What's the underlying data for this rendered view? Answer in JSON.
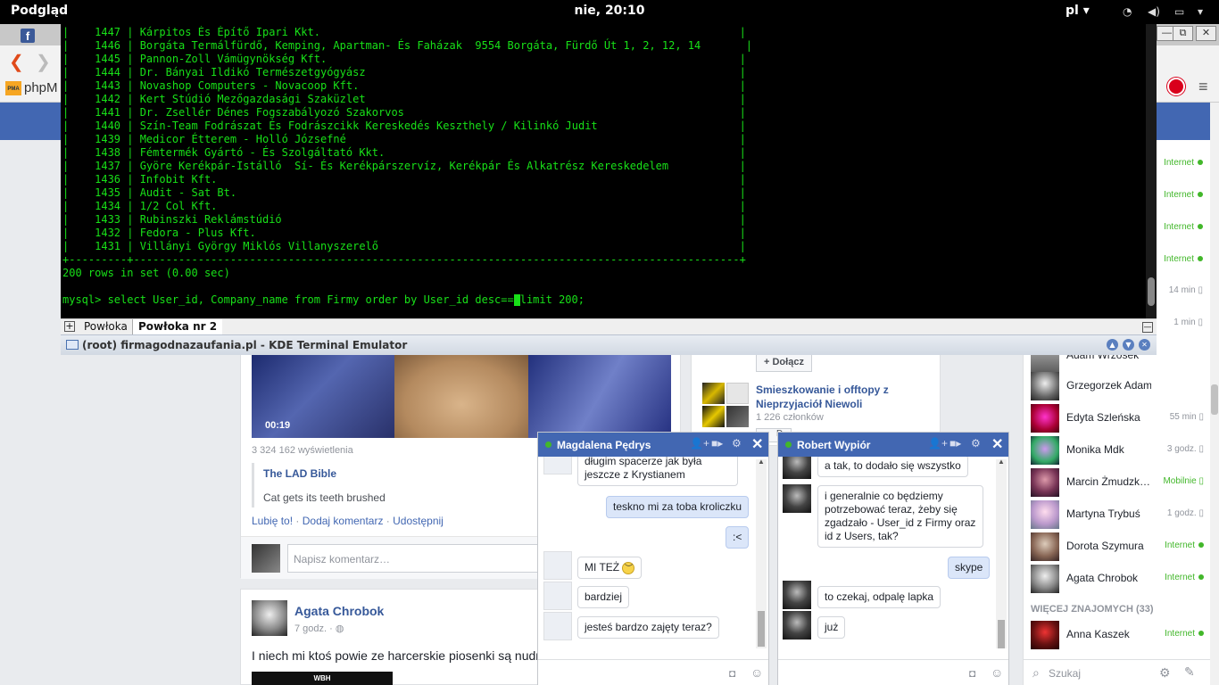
{
  "topbar": {
    "app": "Podgląd",
    "clock": "nie, 20:10",
    "lang": "pl"
  },
  "browser": {
    "phpmyadmin_tab": "phpM",
    "fb_tab": "f"
  },
  "terminal": {
    "rows": [
      "|    1447 | Kárpitos És Építő Ipari Kkt.                                                                 |",
      "|    1446 | Borgáta Termálfürdő, Kemping, Apartman- És Faházak  9554 Borgáta, Fürdő Út 1, 2, 12, 14       |",
      "|    1445 | Pannon-Zoll Vámügynökség Kft.                                                                |",
      "|    1444 | Dr. Bányai Ildikó Természetgyógyász                                                          |",
      "|    1443 | Novashop Computers - Novacoop Kft.                                                           |",
      "|    1442 | Kert Stúdió Mezőgazdasági Szaküzlet                                                          |",
      "|    1441 | Dr. Zsellér Dénes Fogszabályozó Szakorvos                                                    |",
      "|    1440 | Szín-Team Fodrászat És Fodrászcikk Kereskedés Keszthely / Kilinkó Judit                      |",
      "|    1439 | Medicor Étterem - Holló Józsefné                                                             |",
      "|    1438 | Fémtermék Gyártó - És Szolgáltató Kkt.                                                       |",
      "|    1437 | Györe Kerékpár-Istálló  Sí- És Kerékpárszervíz, Kerékpár És Alkatrész Kereskedelem           |",
      "|    1436 | Infobit Kft.                                                                                 |",
      "|    1435 | Audit - Sat Bt.                                                                              |",
      "|    1434 | 1/2 Col Kft.                                                                                 |",
      "|    1433 | Rubinszki Reklámstúdió                                                                       |",
      "|    1432 | Fedora - Plus Kft.                                                                           |",
      "|    1431 | Villányi György Miklós Villanyszerelő                                                        |",
      "+---------+----------------------------------------------------------------------------------------------+",
      "200 rows in set (0.00 sec)",
      ""
    ],
    "prompt_before_cursor": "mysql> select User_id, Company_name from Firmy order by User_id desc==",
    "prompt_after_cursor": "limit 200;",
    "tabs": [
      "Powłoka",
      "Powłoka nr 2"
    ],
    "window_title": "(root) firmagodnazaufania.pl - KDE Terminal Emulator"
  },
  "post1": {
    "duration": "00:19",
    "views": "3 324 162 wyświetlenia",
    "source": "The LAD Bible",
    "caption": "Cat gets its teeth brushed",
    "like": "Lubię to!",
    "comment": "Dodaj komentarz",
    "share": "Udostępnij",
    "comment_placeholder": "Napisz komentarz…"
  },
  "post2": {
    "author": "Agata Chrobok",
    "time": "7 godz. ·",
    "text": "I niech mi ktoś powie ze harcerskie piosenki są nudn",
    "media_label": "WBH"
  },
  "group": {
    "join": "Dołącz",
    "name": "Smieszkowanie i offtopy z Nieprzyjaciół Niewoli",
    "members": "1 226 członków",
    "join2": "D"
  },
  "chat1": {
    "name": "Magdalena Pędrys",
    "messages": [
      "długim spacerze jak była jeszcze z Krystianem",
      "teskno mi za toba kroliczku",
      ":<",
      "MI TEŻ",
      "bardziej",
      "jesteś bardzo zajęty teraz?"
    ]
  },
  "chat2": {
    "name": "Robert Wypiór",
    "messages": [
      "a tak, to dodało się wszystko",
      "i generalnie co będziemy potrzebować teraz, żeby się zgadzało - User_id z Firmy oraz id z Users, tak?",
      "skype",
      "to czekaj, odpalę lapka",
      "już"
    ]
  },
  "sidebar": {
    "partial_statuses": [
      "Internet",
      "Internet",
      "Internet",
      "Internet",
      "14 min",
      "1 min"
    ],
    "partial_name": "Adam Wrzosek",
    "contacts": [
      {
        "name": "Grzegorzek Adam",
        "status": ""
      },
      {
        "name": "Edyta Szleńska",
        "status": "55 min"
      },
      {
        "name": "Monika Mdk",
        "status": "3 godz."
      },
      {
        "name": "Marcin Żmudzk…",
        "status": "Mobilnie"
      },
      {
        "name": "Martyna Trybuś",
        "status": "1 godz."
      },
      {
        "name": "Dorota Szymura",
        "status": "Internet"
      },
      {
        "name": "Agata Chrobok",
        "status": "Internet"
      }
    ],
    "more_label": "WIĘCEJ ZNAJOMYCH (33)",
    "more_contacts": [
      {
        "name": "Anna Kaszek",
        "status": "Internet"
      }
    ],
    "search_placeholder": "Szukaj"
  }
}
